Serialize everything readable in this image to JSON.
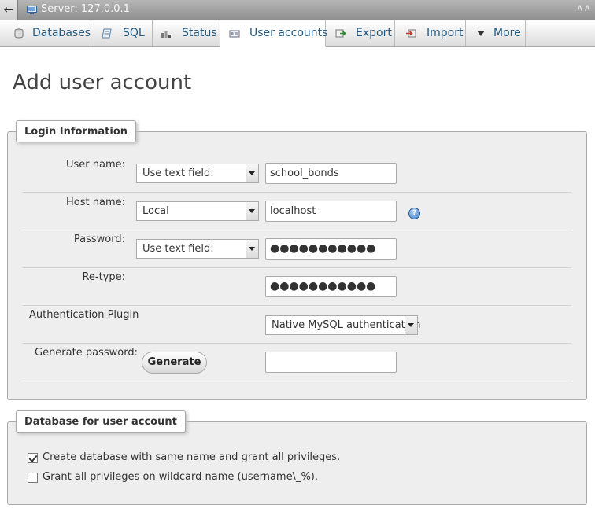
{
  "topbar": {
    "back_glyph": "←",
    "server_label": "Server: 127.0.0.1",
    "collapse_glyph": "∧∧"
  },
  "tabs": [
    {
      "label": "Databases",
      "icon": "database-icon",
      "active": false
    },
    {
      "label": "SQL",
      "icon": "sql-icon",
      "active": false
    },
    {
      "label": "Status",
      "icon": "status-icon",
      "active": false
    },
    {
      "label": "User accounts",
      "icon": "user-accounts-icon",
      "active": true
    },
    {
      "label": "Export",
      "icon": "export-icon",
      "active": false
    },
    {
      "label": "Import",
      "icon": "import-icon",
      "active": false
    },
    {
      "label": "More",
      "icon": "chevron-down-icon",
      "active": false
    }
  ],
  "page": {
    "title": "Add user account"
  },
  "login": {
    "legend": "Login Information",
    "user_name": {
      "label": "User name:",
      "select": "Use text field:",
      "value": "school_bonds"
    },
    "host_name": {
      "label": "Host name:",
      "select": "Local",
      "value": "localhost"
    },
    "password": {
      "label": "Password:",
      "select": "Use text field:",
      "value": "●●●●●●●●●●●"
    },
    "retype": {
      "label": "Re-type:",
      "value": "●●●●●●●●●●●"
    },
    "auth_plugin": {
      "label": "Authentication Plugin",
      "select": "Native MySQL authentication"
    },
    "generate": {
      "label": "Generate password:",
      "button": "Generate",
      "value": ""
    }
  },
  "database": {
    "legend": "Database for user account",
    "options": [
      {
        "label": "Create database with same name and grant all privileges.",
        "checked": true
      },
      {
        "label": "Grant all privileges on wildcard name (username\\_%).",
        "checked": false
      }
    ]
  },
  "colors": {
    "tab_text": "#235a81",
    "fieldset_bg": "#eeeeee",
    "topbar": "#9c9c9c"
  }
}
